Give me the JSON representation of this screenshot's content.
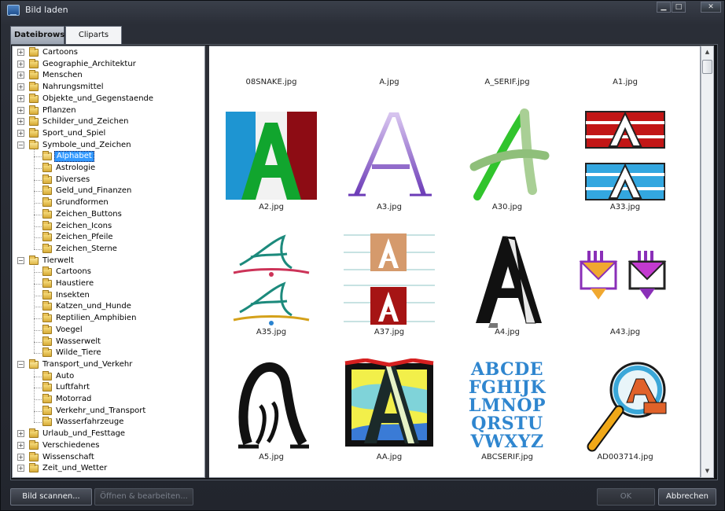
{
  "window": {
    "title": "Bild laden",
    "controls": {
      "minimize": "▁",
      "maximize": "□",
      "close": "✕"
    }
  },
  "tabs": [
    {
      "label": "Dateibrowser",
      "active": false
    },
    {
      "label": "Cliparts",
      "active": true
    }
  ],
  "tree": {
    "expander_collapsed": "+",
    "expander_expanded": "−",
    "items": [
      {
        "label": "Cartoons",
        "level": 0,
        "expandable": true,
        "expanded": false
      },
      {
        "label": "Geographie_Architektur",
        "level": 0,
        "expandable": true,
        "expanded": false
      },
      {
        "label": "Menschen",
        "level": 0,
        "expandable": true,
        "expanded": false
      },
      {
        "label": "Nahrungsmittel",
        "level": 0,
        "expandable": true,
        "expanded": false
      },
      {
        "label": "Objekte_und_Gegenstaende",
        "level": 0,
        "expandable": true,
        "expanded": false
      },
      {
        "label": "Pflanzen",
        "level": 0,
        "expandable": true,
        "expanded": false
      },
      {
        "label": "Schilder_und_Zeichen",
        "level": 0,
        "expandable": true,
        "expanded": false
      },
      {
        "label": "Sport_und_Spiel",
        "level": 0,
        "expandable": true,
        "expanded": false
      },
      {
        "label": "Symbole_und_Zeichen",
        "level": 0,
        "expandable": true,
        "expanded": true
      },
      {
        "label": "Alphabet",
        "level": 1,
        "expandable": false,
        "selected": true
      },
      {
        "label": "Astrologie",
        "level": 1,
        "expandable": false
      },
      {
        "label": "Diverses",
        "level": 1,
        "expandable": false
      },
      {
        "label": "Geld_und_Finanzen",
        "level": 1,
        "expandable": false
      },
      {
        "label": "Grundformen",
        "level": 1,
        "expandable": false
      },
      {
        "label": "Zeichen_Buttons",
        "level": 1,
        "expandable": false
      },
      {
        "label": "Zeichen_Icons",
        "level": 1,
        "expandable": false
      },
      {
        "label": "Zeichen_Pfeile",
        "level": 1,
        "expandable": false
      },
      {
        "label": "Zeichen_Sterne",
        "level": 1,
        "expandable": false
      },
      {
        "label": "Tierwelt",
        "level": 0,
        "expandable": true,
        "expanded": true
      },
      {
        "label": "Cartoons",
        "level": 1,
        "expandable": false
      },
      {
        "label": "Haustiere",
        "level": 1,
        "expandable": false
      },
      {
        "label": "Insekten",
        "level": 1,
        "expandable": false
      },
      {
        "label": "Katzen_und_Hunde",
        "level": 1,
        "expandable": false
      },
      {
        "label": "Reptilien_Amphibien",
        "level": 1,
        "expandable": false
      },
      {
        "label": "Voegel",
        "level": 1,
        "expandable": false
      },
      {
        "label": "Wasserwelt",
        "level": 1,
        "expandable": false
      },
      {
        "label": "Wilde_Tiere",
        "level": 1,
        "expandable": false
      },
      {
        "label": "Transport_und_Verkehr",
        "level": 0,
        "expandable": true,
        "expanded": true
      },
      {
        "label": "Auto",
        "level": 1,
        "expandable": false
      },
      {
        "label": "Luftfahrt",
        "level": 1,
        "expandable": false
      },
      {
        "label": "Motorrad",
        "level": 1,
        "expandable": false
      },
      {
        "label": "Verkehr_und_Transport",
        "level": 1,
        "expandable": false
      },
      {
        "label": "Wasserfahrzeuge",
        "level": 1,
        "expandable": false
      },
      {
        "label": "Urlaub_und_Festtage",
        "level": 0,
        "expandable": true,
        "expanded": false
      },
      {
        "label": "Verschiedenes",
        "level": 0,
        "expandable": true,
        "expanded": false
      },
      {
        "label": "Wissenschaft",
        "level": 0,
        "expandable": true,
        "expanded": false
      },
      {
        "label": "Zeit_und_Wetter",
        "level": 0,
        "expandable": true,
        "expanded": false
      }
    ]
  },
  "thumbnails": [
    {
      "filename": "08SNAKE.jpg",
      "icon": "snake-letter-clipart"
    },
    {
      "filename": "A.jpg",
      "icon": "letter-a-black-clipart"
    },
    {
      "filename": "A_SERIF.jpg",
      "icon": "letter-a-blue-serif-clipart"
    },
    {
      "filename": "A1.jpg",
      "icon": "letter-a-script-clipart"
    },
    {
      "filename": "A2.jpg",
      "icon": "letter-a-tricolor-clipart"
    },
    {
      "filename": "A3.jpg",
      "icon": "letter-a-purple-outline-clipart"
    },
    {
      "filename": "A30.jpg",
      "icon": "letter-a-green-brush-clipart"
    },
    {
      "filename": "A33.jpg",
      "icon": "letter-a-banners-clipart"
    },
    {
      "filename": "A35.jpg",
      "icon": "letter-a-calligraphy-clipart"
    },
    {
      "filename": "A37.jpg",
      "icon": "letter-a-tiles-clipart"
    },
    {
      "filename": "A4.jpg",
      "icon": "letter-a-3d-black-clipart"
    },
    {
      "filename": "A43.jpg",
      "icon": "letter-a-envelopes-clipart"
    },
    {
      "filename": "A5.jpg",
      "icon": "letter-a-ornate-black-clipart"
    },
    {
      "filename": "AA.jpg",
      "icon": "letter-a-framed-color-clipart"
    },
    {
      "filename": "ABCSERIF.jpg",
      "icon": "alphabet-serif-clipart",
      "text_lines": [
        "ABCDE",
        "FGHIJK",
        "LMNOP",
        "QRSTU",
        "VWXYZ"
      ]
    },
    {
      "filename": "AD003714.jpg",
      "icon": "magnifier-letter-clipart"
    }
  ],
  "buttons": {
    "scan": "Bild scannen...",
    "open_edit": "Öffnen & bearbeiten...",
    "ok": "OK",
    "cancel": "Abbrechen"
  },
  "colors": {
    "selection": "#3399ff",
    "window_frame": "#2a2e37"
  }
}
